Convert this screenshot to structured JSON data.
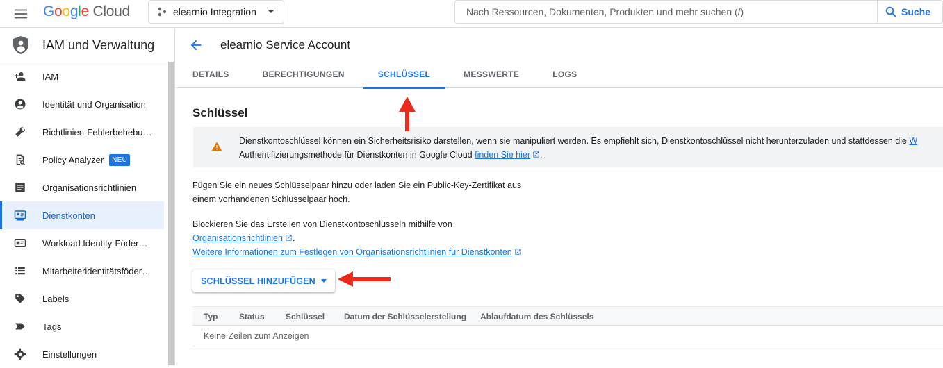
{
  "topbar": {
    "logo_parts": [
      "G",
      "o",
      "o",
      "g",
      "l",
      "e"
    ],
    "logo_cloud": "Cloud",
    "project_name": "elearnio Integration",
    "search_placeholder": "Nach Ressourcen, Dokumenten, Produkten und mehr suchen (/)",
    "search_button": "Suche"
  },
  "sidebar": {
    "title": "IAM und Verwaltung",
    "items": [
      {
        "label": "IAM",
        "icon": "person-add-icon"
      },
      {
        "label": "Identität und Organisation",
        "icon": "account-circle-icon"
      },
      {
        "label": "Richtlinien-Fehlerbehebung",
        "icon": "wrench-icon"
      },
      {
        "label": "Policy Analyzer",
        "icon": "policy-analyzer-icon",
        "badge": "NEU"
      },
      {
        "label": "Organisationsrichtlinien",
        "icon": "list-alt-icon"
      },
      {
        "label": "Dienstkonten",
        "icon": "service-account-icon",
        "active": true
      },
      {
        "label": "Workload Identity-Föderation",
        "icon": "id-card-icon"
      },
      {
        "label": "Mitarbeiteridentitätsföderation",
        "icon": "list-icon"
      },
      {
        "label": "Labels",
        "icon": "label-icon"
      },
      {
        "label": "Tags",
        "icon": "tag-icon"
      },
      {
        "label": "Einstellungen",
        "icon": "settings-icon"
      }
    ]
  },
  "main": {
    "title": "elearnio Service Account",
    "tabs": [
      "DETAILS",
      "BERECHTIGUNGEN",
      "SCHLÜSSEL",
      "MESSWERTE",
      "LOGS"
    ],
    "active_tab": "SCHLÜSSEL",
    "section_title": "Schlüssel",
    "warning": {
      "line1": "Dienstkontoschlüssel können ein Sicherheitsrisiko darstellen, wenn sie manipuliert werden. Es empfiehlt sich, Dienstkontoschlüssel nicht herunterzuladen und stattdessen die ",
      "line1_link": "W",
      "line2": "Authentifizierungsmethode für Dienstkonten in Google Cloud ",
      "line2_link": "finden Sie hier",
      "line2_end": "."
    },
    "para1_line1": "Fügen Sie ein neues Schlüsselpaar hinzu oder laden Sie ein Public-Key-Zertifikat aus",
    "para1_line2": "einem vorhandenen Schlüsselpaar hoch.",
    "para2_line1": "Blockieren Sie das Erstellen von Dienstkontoschlüsseln mithilfe von",
    "para2_link1": "Organisationsrichtlinien",
    "para2_link1_end": ".",
    "para2_link2": "Weitere Informationen zum Festlegen von Organisationsrichtlinien für Dienstkonten",
    "add_key_button": "SCHLÜSSEL HINZUFÜGEN",
    "table": {
      "columns": [
        "Typ",
        "Status",
        "Schlüssel",
        "Datum der Schlüsselerstellung",
        "Ablaufdatum des Schlüssels"
      ],
      "empty_text": "Keine Zeilen zum Anzeigen"
    }
  },
  "colors": {
    "accent": "#1a73e8",
    "annotation_arrow": "#ea2a1b",
    "warning_icon": "#e37400"
  }
}
